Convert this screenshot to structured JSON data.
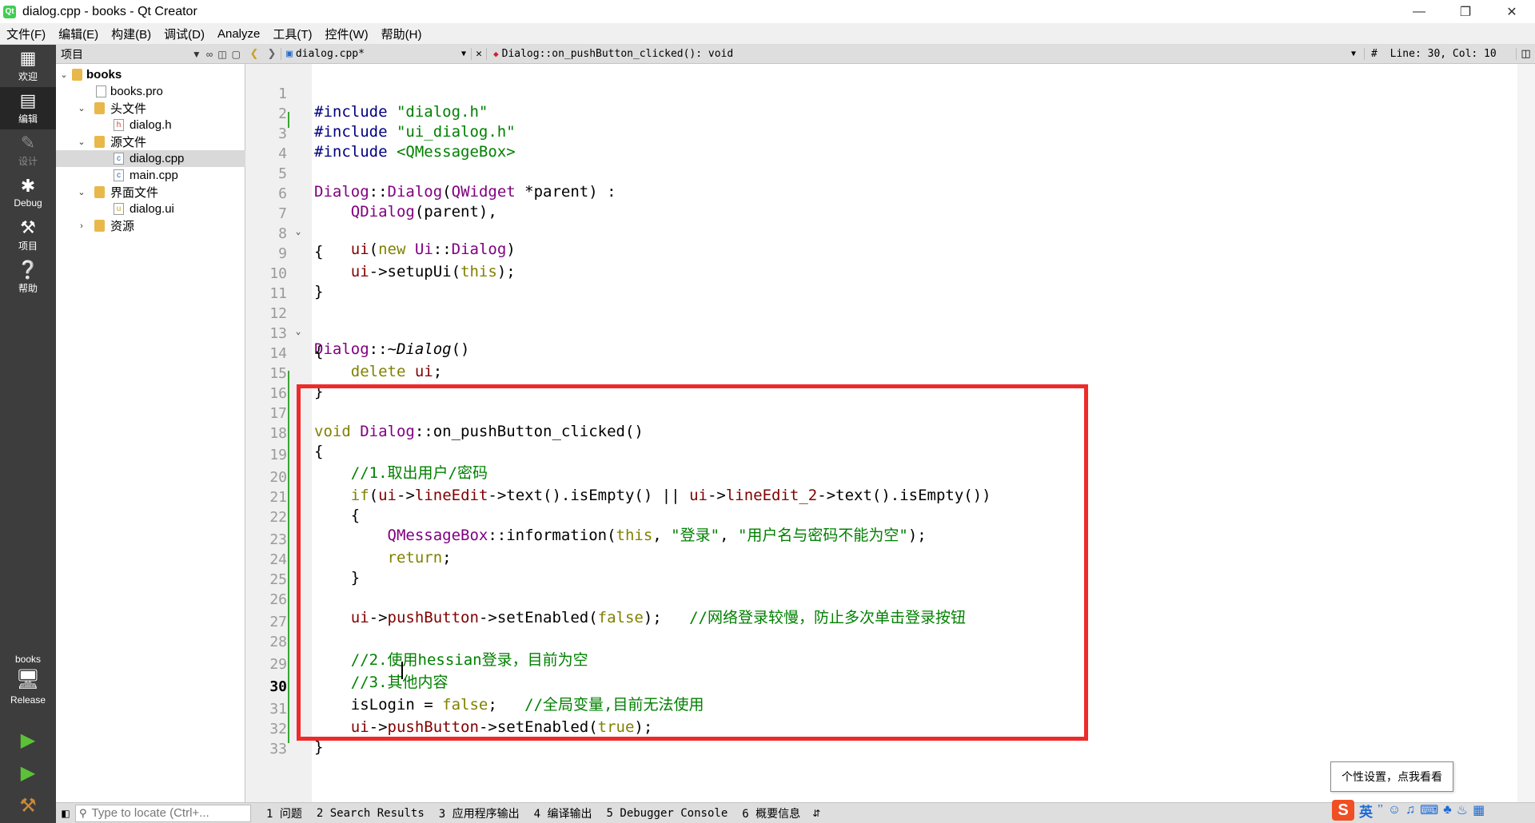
{
  "window": {
    "app_icon": "qt-icon",
    "title": "dialog.cpp - books - Qt Creator",
    "controls": [
      "minimize-icon",
      "restore-icon",
      "close-icon"
    ]
  },
  "menu": [
    "文件(F)",
    "编辑(E)",
    "构建(B)",
    "调试(D)",
    "Analyze",
    "工具(T)",
    "控件(W)",
    "帮助(H)"
  ],
  "modes": {
    "welcome": "欢迎",
    "edit": "编辑",
    "design": "设计",
    "debug": "Debug",
    "projects": "项目",
    "help": "帮助",
    "kit_project": "books",
    "kit_build": "Release"
  },
  "project_panel": {
    "title": "项目",
    "tree": {
      "root": "books",
      "pro_file": "books.pro",
      "headers_folder": "头文件",
      "header_file": "dialog.h",
      "sources_folder": "源文件",
      "source_file_1": "dialog.cpp",
      "source_file_2": "main.cpp",
      "forms_folder": "界面文件",
      "form_file": "dialog.ui",
      "resources_folder": "资源"
    }
  },
  "editor_toolbar": {
    "file": "dialog.cpp*",
    "symbol": "Dialog::on_pushButton_clicked(): void",
    "hash": "#",
    "position": "Line: 30, Col: 10"
  },
  "editor": {
    "line_numbers": [
      "1",
      "2",
      "3",
      "4",
      "5",
      "6",
      "7",
      "8",
      "9",
      "10",
      "11",
      "12",
      "13",
      "14",
      "15",
      "16",
      "17",
      "18",
      "19",
      "20",
      "21",
      "22",
      "23",
      "24",
      "25",
      "26",
      "27",
      "28",
      "29",
      "30",
      "31",
      "32",
      "33"
    ],
    "current_line": "30",
    "code": {
      "l1": {
        "kw": "#include ",
        "str": "\"dialog.h\""
      },
      "l2": {
        "kw": "#include ",
        "str": "\"ui_dialog.h\""
      },
      "l3": {
        "kw": "#include ",
        "str": "<QMessageBox>"
      },
      "l5": {
        "a": "Dialog",
        "b": "::",
        "c": "Dialog",
        "d": "(",
        "e": "QWidget",
        "f": " *parent) :"
      },
      "l6": {
        "a": "QDialog",
        "b": "(parent),"
      },
      "l7": {
        "a": "ui",
        "b": "(",
        "c": "new",
        "d": " ",
        "e": "Ui",
        "f": "::",
        "g": "Dialog",
        "h": ")"
      },
      "l8": "{",
      "l9": {
        "a": "ui",
        "b": "->setupUi(",
        "c": "this",
        "d": ");"
      },
      "l10": "}",
      "l12": {
        "a": "Dialog",
        "b": "::~",
        "c": "Dialog",
        "d": "()"
      },
      "l13": "{",
      "l14": {
        "a": "delete",
        "b": " ",
        "c": "ui",
        "d": ";"
      },
      "l15": "}",
      "l17": {
        "a": "void",
        "b": " ",
        "c": "Dialog",
        "d": "::on_pushButton_clicked()"
      },
      "l18": "{",
      "l19": "//1.取出用户/密码",
      "l20": {
        "a": "if",
        "b": "(",
        "c": "ui",
        "d": "->",
        "e": "lineEdit",
        "f": "->text().isEmpty() || ",
        "g": "ui",
        "h": "->",
        "i": "lineEdit_2",
        "j": "->text().isEmpty())"
      },
      "l21": "{",
      "l22": {
        "a": "QMessageBox",
        "b": "::information(",
        "c": "this",
        "d": ", ",
        "e": "\"登录\"",
        "f": ", ",
        "g": "\"用户名与密码不能为空\"",
        "h": ");"
      },
      "l23": {
        "a": "return",
        "b": ";"
      },
      "l24": "}",
      "l26": {
        "a": "ui",
        "b": "->",
        "c": "pushButton",
        "d": "->setEnabled(",
        "e": "false",
        "f": ");   ",
        "g": "//网络登录较慢，防止多次单击登录按钮"
      },
      "l28": "//2.使用hessian登录，目前为空",
      "l29": "//3.其他内容",
      "l30": {
        "a": "isLogin = ",
        "b": "false",
        "c": ";   ",
        "d": "//全局变量,目前无法使用"
      },
      "l31": {
        "a": "ui",
        "b": "->",
        "c": "pushButton",
        "d": "->setEnabled(",
        "e": "true",
        "f": ");"
      },
      "l32": "}"
    },
    "highlight_color": "#ee2b2b"
  },
  "output_bar": {
    "locator_placeholder": "Type to locate (Ctrl+...",
    "panes": [
      {
        "num": "1",
        "label": "问题"
      },
      {
        "num": "2",
        "label": "Search Results"
      },
      {
        "num": "3",
        "label": "应用程序输出"
      },
      {
        "num": "4",
        "label": "编译输出"
      },
      {
        "num": "5",
        "label": "Debugger Console"
      },
      {
        "num": "6",
        "label": "概要信息"
      }
    ]
  },
  "ime": {
    "tooltip": "个性设置，点我看看",
    "logo": "S",
    "lang": "英",
    "icons": [
      "punctuation-icon",
      "emoji-icon",
      "mic-icon",
      "keyboard-icon",
      "skin-icon",
      "clothes-icon",
      "grid-icon"
    ]
  },
  "colors": {
    "mode_bar": "#3d3d3d",
    "keyword": "#808000",
    "string": "#008000",
    "preprocessor": "#000080",
    "class": "#800080",
    "member": "#800000"
  }
}
